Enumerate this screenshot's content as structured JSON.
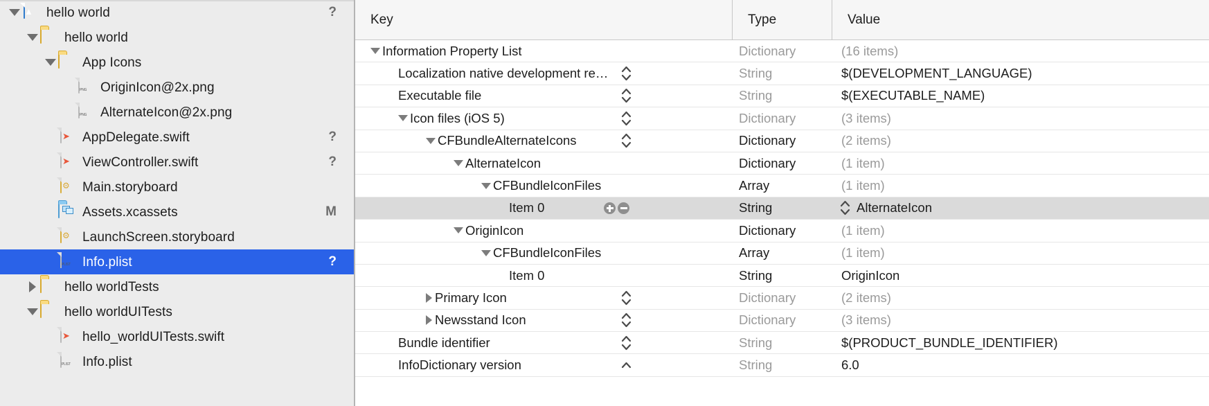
{
  "sidebar": {
    "rows": [
      {
        "label": "hello world",
        "indent": 0,
        "disclosure": "down",
        "icon": "app-icon",
        "status": "?"
      },
      {
        "label": "hello world",
        "indent": 1,
        "disclosure": "down",
        "icon": "folder-icon",
        "status": ""
      },
      {
        "label": "App Icons",
        "indent": 2,
        "disclosure": "down",
        "icon": "folder-icon",
        "status": ""
      },
      {
        "label": "OriginIcon@2x.png",
        "indent": 3,
        "disclosure": "none",
        "icon": "png-file-icon",
        "status": ""
      },
      {
        "label": "AlternateIcon@2x.png",
        "indent": 3,
        "disclosure": "none",
        "icon": "png-file-icon",
        "status": ""
      },
      {
        "label": "AppDelegate.swift",
        "indent": 2,
        "disclosure": "none",
        "icon": "swift-file-icon",
        "status": "?"
      },
      {
        "label": "ViewController.swift",
        "indent": 2,
        "disclosure": "none",
        "icon": "swift-file-icon",
        "status": "?"
      },
      {
        "label": "Main.storyboard",
        "indent": 2,
        "disclosure": "none",
        "icon": "storyboard-file-icon",
        "status": ""
      },
      {
        "label": "Assets.xcassets",
        "indent": 2,
        "disclosure": "none",
        "icon": "xcassets-icon",
        "status": "M"
      },
      {
        "label": "LaunchScreen.storyboard",
        "indent": 2,
        "disclosure": "none",
        "icon": "storyboard-file-icon",
        "status": ""
      },
      {
        "label": "Info.plist",
        "indent": 2,
        "disclosure": "none",
        "icon": "plist-file-icon",
        "status": "?",
        "selected": true
      },
      {
        "label": "hello worldTests",
        "indent": 1,
        "disclosure": "right",
        "icon": "folder-icon",
        "status": ""
      },
      {
        "label": "hello worldUITests",
        "indent": 1,
        "disclosure": "down",
        "icon": "folder-icon",
        "status": ""
      },
      {
        "label": "hello_worldUITests.swift",
        "indent": 2,
        "disclosure": "none",
        "icon": "swift-file-icon",
        "status": ""
      },
      {
        "label": "Info.plist",
        "indent": 2,
        "disclosure": "none",
        "icon": "plist-file-icon",
        "status": ""
      }
    ]
  },
  "plist": {
    "columns": {
      "key": "Key",
      "type": "Type",
      "value": "Value"
    },
    "rows": [
      {
        "key": "Information Property List",
        "indent": 0,
        "disclosure": "down",
        "type": "Dictionary",
        "type_muted": true,
        "value": "(16 items)",
        "value_muted": true,
        "stepper": false
      },
      {
        "key": "Localization native development re…",
        "indent": 1,
        "disclosure": "none",
        "type": "String",
        "type_muted": true,
        "value": "$(DEVELOPMENT_LANGUAGE)",
        "value_muted": false,
        "stepper": true
      },
      {
        "key": "Executable file",
        "indent": 1,
        "disclosure": "none",
        "type": "String",
        "type_muted": true,
        "value": "$(EXECUTABLE_NAME)",
        "value_muted": false,
        "stepper": true
      },
      {
        "key": "Icon files (iOS 5)",
        "indent": 1,
        "disclosure": "down",
        "type": "Dictionary",
        "type_muted": true,
        "value": "(3 items)",
        "value_muted": true,
        "stepper": true
      },
      {
        "key": "CFBundleAlternateIcons",
        "indent": 2,
        "disclosure": "down",
        "type": "Dictionary",
        "type_muted": false,
        "value": "(2 items)",
        "value_muted": true,
        "stepper": true
      },
      {
        "key": "AlternateIcon",
        "indent": 3,
        "disclosure": "down",
        "type": "Dictionary",
        "type_muted": false,
        "value": "(1 item)",
        "value_muted": true,
        "stepper": false
      },
      {
        "key": "CFBundleIconFiles",
        "indent": 4,
        "disclosure": "down",
        "type": "Array",
        "type_muted": false,
        "value": "(1 item)",
        "value_muted": true,
        "stepper": false
      },
      {
        "key": "Item 0",
        "indent": 5,
        "disclosure": "none",
        "type": "String",
        "type_muted": false,
        "value": "AlternateIcon",
        "value_muted": false,
        "stepper": false,
        "selected": true,
        "plusminus": true,
        "value_stepper": true
      },
      {
        "key": "OriginIcon",
        "indent": 3,
        "disclosure": "down",
        "type": "Dictionary",
        "type_muted": false,
        "value": "(1 item)",
        "value_muted": true,
        "stepper": false
      },
      {
        "key": "CFBundleIconFiles",
        "indent": 4,
        "disclosure": "down",
        "type": "Array",
        "type_muted": false,
        "value": "(1 item)",
        "value_muted": true,
        "stepper": false
      },
      {
        "key": "Item 0",
        "indent": 5,
        "disclosure": "none",
        "type": "String",
        "type_muted": false,
        "value": "OriginIcon",
        "value_muted": false,
        "stepper": false
      },
      {
        "key": "Primary Icon",
        "indent": 2,
        "disclosure": "right",
        "type": "Dictionary",
        "type_muted": true,
        "value": "(2 items)",
        "value_muted": true,
        "stepper": true
      },
      {
        "key": "Newsstand Icon",
        "indent": 2,
        "disclosure": "right",
        "type": "Dictionary",
        "type_muted": true,
        "value": "(3 items)",
        "value_muted": true,
        "stepper": true
      },
      {
        "key": "Bundle identifier",
        "indent": 1,
        "disclosure": "none",
        "type": "String",
        "type_muted": true,
        "value": "$(PRODUCT_BUNDLE_IDENTIFIER)",
        "value_muted": false,
        "stepper": true
      },
      {
        "key": "InfoDictionary version",
        "indent": 1,
        "disclosure": "none",
        "type": "String",
        "type_muted": true,
        "value": "6.0",
        "value_muted": false,
        "stepper": true
      }
    ]
  },
  "colors": {
    "selection_blue": "#2a62e8",
    "row_selected_gray": "#dadada",
    "sidebar_bg": "#ececec",
    "header_bg": "#f6f6f6",
    "muted_text": "#9a9a9a"
  }
}
